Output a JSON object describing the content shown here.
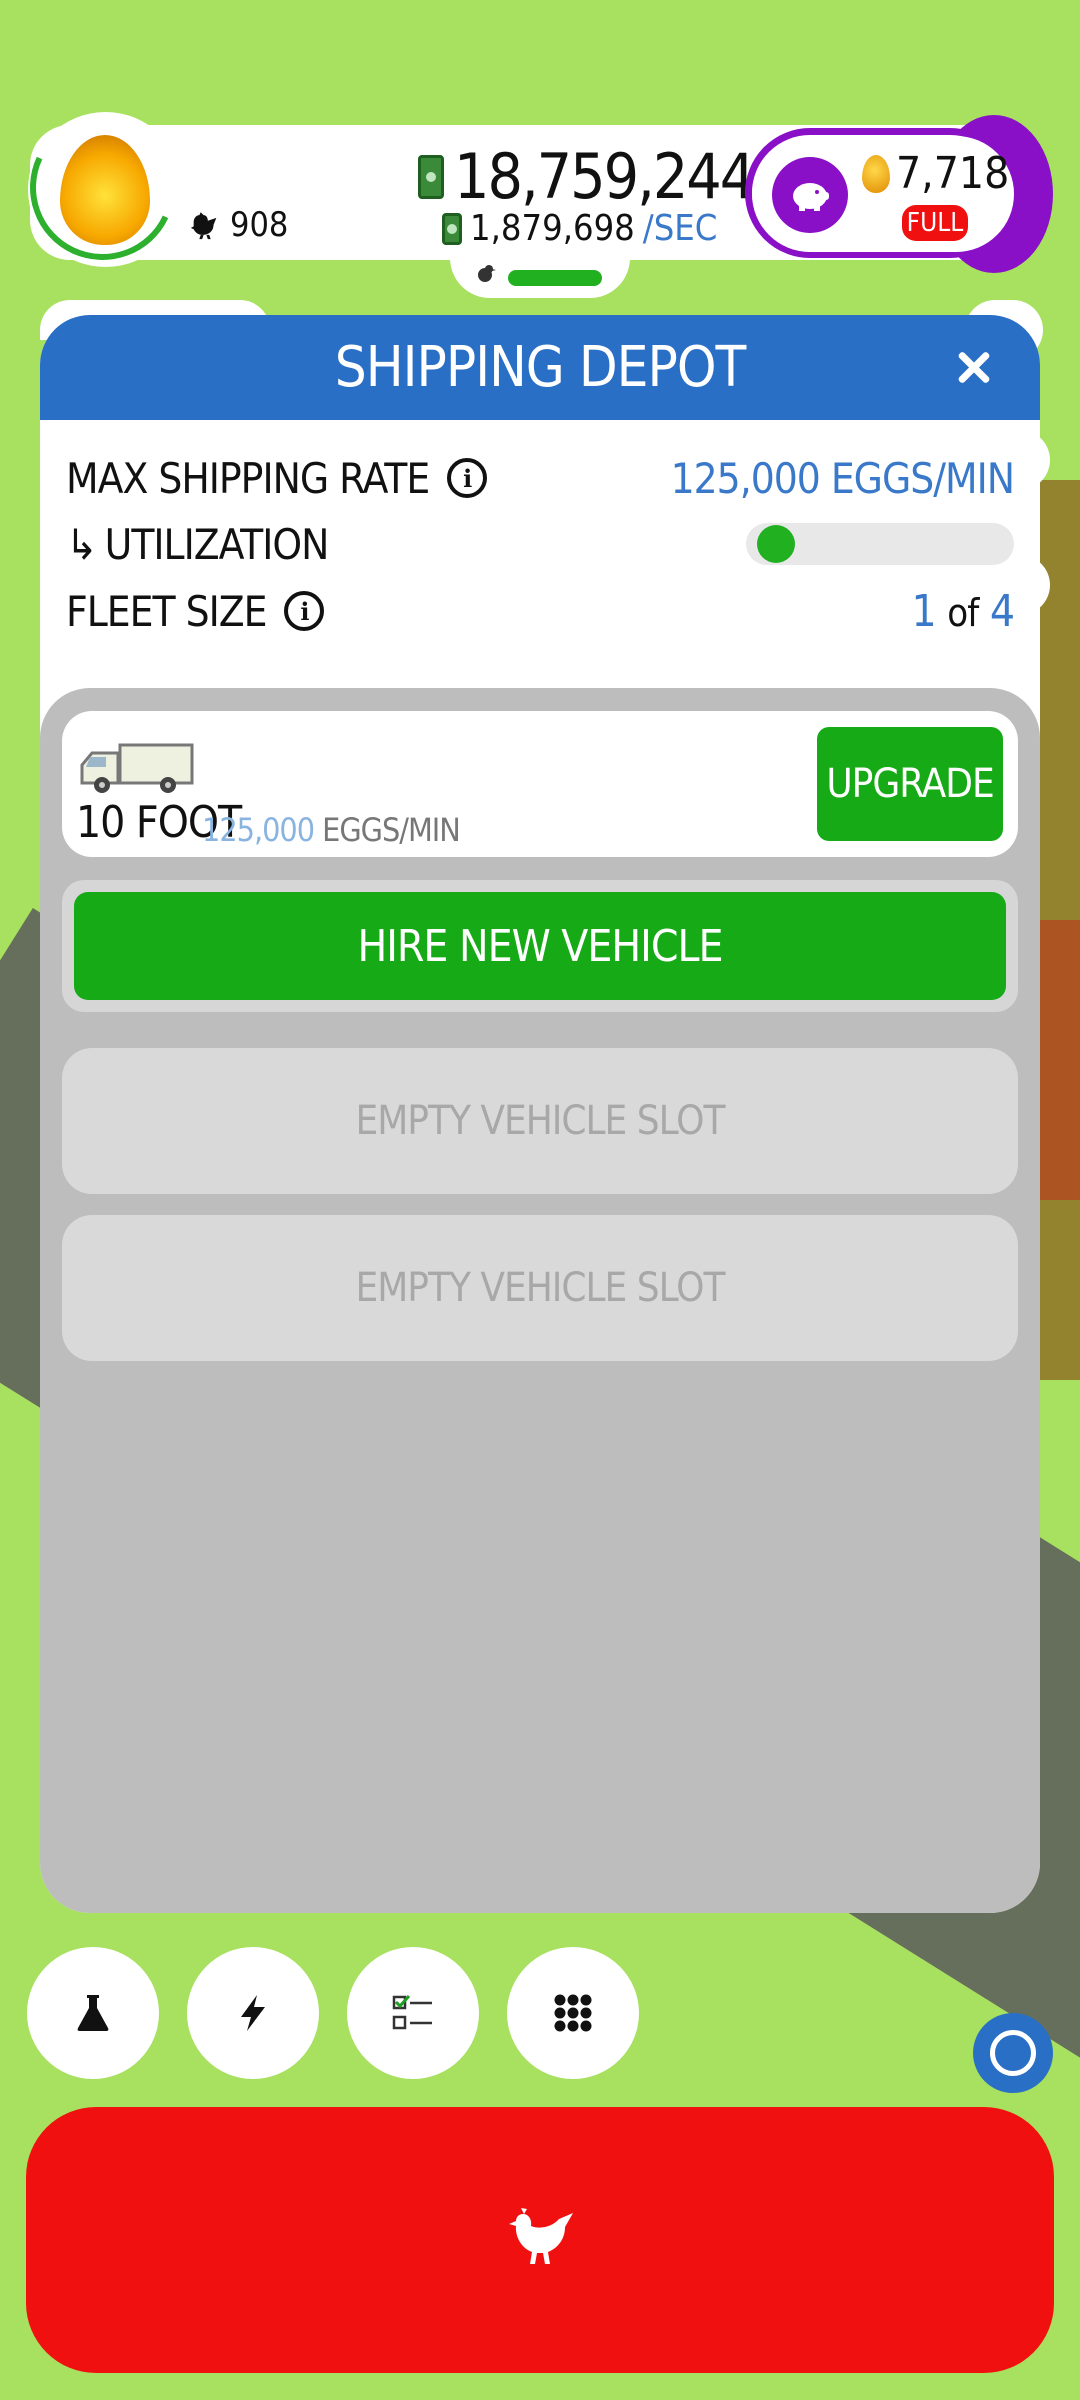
{
  "hud": {
    "chicken_count": "908",
    "money": "18,759,244",
    "money_rate": "1,879,698",
    "money_rate_unit": "/SEC",
    "golden_eggs": "7,718",
    "piggy_status": "FULL"
  },
  "modal": {
    "title": "SHIPPING DEPOT",
    "max_shipping_rate_label": "MAX SHIPPING RATE",
    "max_shipping_rate_value": "125,000 EGGS/MIN",
    "utilization_label": "UTILIZATION",
    "utilization_arrow": "↳",
    "utilization_fraction": 0.03,
    "fleet_size_label": "FLEET SIZE",
    "fleet_current": "1",
    "fleet_of": "of",
    "fleet_max": "4",
    "info_glyph": "i"
  },
  "vehicles": [
    {
      "name": "10 FOOT",
      "rate": "125,000",
      "rate_unit": "EGGS/MIN",
      "action": "UPGRADE"
    }
  ],
  "hire_button": "HIRE NEW VEHICLE",
  "empty_slots": [
    "EMPTY VEHICLE SLOT",
    "EMPTY VEHICLE SLOT"
  ],
  "bottom_buttons": [
    "flask-icon",
    "lightning-icon",
    "checklist-icon",
    "grid-icon"
  ],
  "colors": {
    "background": "#a8e05f",
    "header_blue": "#2a6fc6",
    "accent_green": "#16ab16",
    "hatch_red": "#f01010",
    "piggy_purple": "#8a10c8",
    "value_blue": "#3a79c9"
  }
}
